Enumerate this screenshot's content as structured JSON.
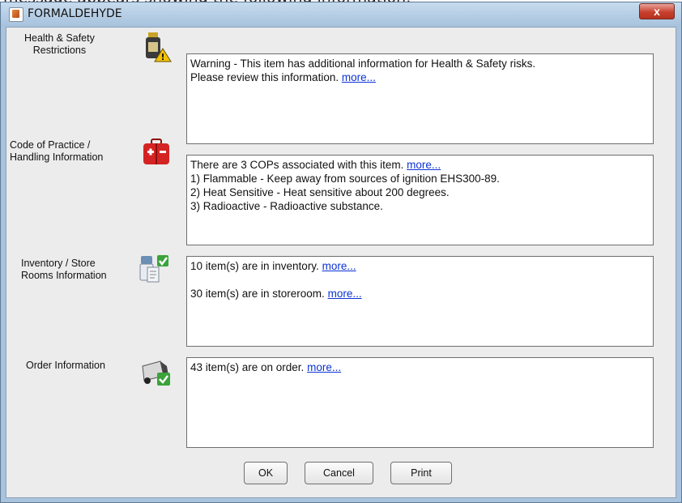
{
  "caption": "message appears showing the following information:",
  "window": {
    "title": "FORMALDEHYDE",
    "close_label": "x"
  },
  "sections": {
    "health": {
      "label_line1": "Health & Safety",
      "label_line2": "Restrictions",
      "icon": "bottle-warning-icon",
      "line1": "Warning - This item has additional information for Health & Safety risks.",
      "line2": "Please review this information.",
      "more": "more..."
    },
    "cop": {
      "label_line1": "Code of Practice /",
      "label_line2": "Handling Information",
      "icon": "first-aid-kit-icon",
      "line1": "There are 3 COPs associated with this item.",
      "more": "more...",
      "items": [
        "1) Flammable - Keep away from sources of ignition EHS300-89.",
        "2) Heat Sensitive - Heat sensitive about 200 degrees.",
        "3) Radioactive - Radioactive substance."
      ]
    },
    "inventory": {
      "label_line1": "Inventory / Store",
      "label_line2": "Rooms Information",
      "icon": "inventory-check-icon",
      "line1": "10 item(s) are in inventory.",
      "line2": "30 item(s) are in storeroom.",
      "more1": "more...",
      "more2": "more..."
    },
    "order": {
      "label": "Order Information",
      "icon": "truck-check-icon",
      "line1": "43 item(s) are on order.",
      "more": "more..."
    }
  },
  "buttons": {
    "ok": "OK",
    "cancel": "Cancel",
    "print": "Print"
  }
}
